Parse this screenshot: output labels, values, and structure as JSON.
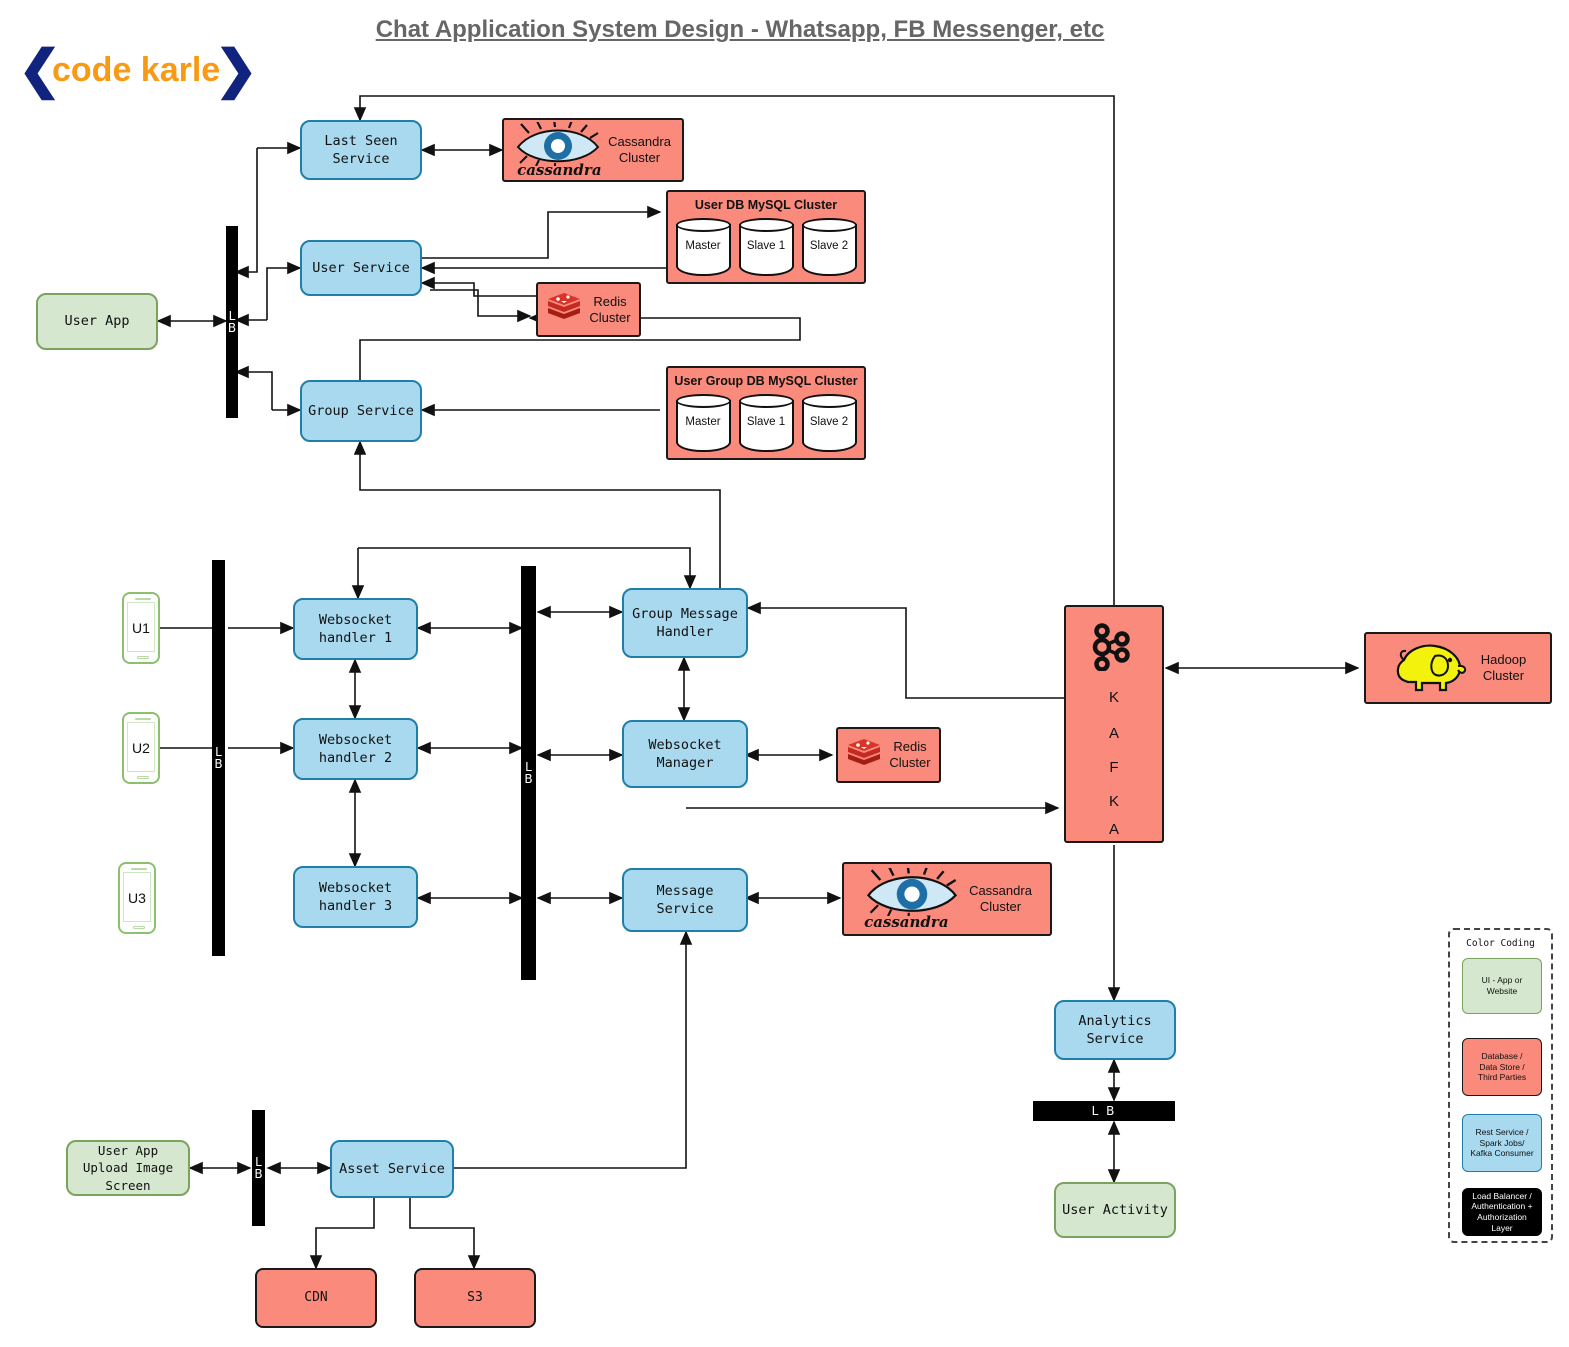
{
  "page": {
    "title": "Chat Application System Design - Whatsapp, FB Messenger, etc",
    "logo": {
      "left_bracket": "❮",
      "word": "code karle",
      "right_bracket": "❯"
    }
  },
  "colors": {
    "service": "#a8d9ef",
    "service_border": "#1f7fa8",
    "datastore": "#fa8a7c",
    "ui": "#d5e8cf",
    "ui_border": "#7aa35f",
    "loadbalancer": "#000000",
    "title_text": "#666666",
    "logo_bracket": "#10237e",
    "logo_word": "#f89a16"
  },
  "ui_clients": {
    "user_app": "User App",
    "user_app_upload": "User App\nUpload Image\nScreen",
    "user_activity": "User Activity",
    "phones": [
      {
        "label": "U1"
      },
      {
        "label": "U2"
      },
      {
        "label": "U3"
      }
    ]
  },
  "load_balancers": {
    "label": "LB",
    "letters": {
      "l": "L",
      "b": "B"
    },
    "horizontal_label": "L B",
    "instances": [
      {
        "name": "lb-user-app"
      },
      {
        "name": "lb-clients"
      },
      {
        "name": "lb-handlers"
      },
      {
        "name": "lb-upload"
      },
      {
        "name": "lb-analytics"
      }
    ]
  },
  "services": [
    {
      "id": "last-seen-service",
      "label": "Last Seen\nService"
    },
    {
      "id": "user-service",
      "label": "User Service"
    },
    {
      "id": "group-service",
      "label": "Group Service"
    },
    {
      "id": "websocket-handler-1",
      "label": "Websocket\nhandler 1"
    },
    {
      "id": "websocket-handler-2",
      "label": "Websocket\nhandler 2"
    },
    {
      "id": "websocket-handler-3",
      "label": "Websocket\nhandler 3"
    },
    {
      "id": "group-message-handler",
      "label": "Group Message\nHandler"
    },
    {
      "id": "websocket-manager",
      "label": "Websocket\nManager"
    },
    {
      "id": "message-service",
      "label": "Message\nService"
    },
    {
      "id": "analytics-service",
      "label": "Analytics\nService"
    },
    {
      "id": "asset-service",
      "label": "Asset Service"
    }
  ],
  "datastores": {
    "cassandra_last_seen": {
      "label": "Cassandra\nCluster",
      "wordmark": "cassandra"
    },
    "cassandra_message": {
      "label": "Cassandra\nCluster",
      "wordmark": "cassandra"
    },
    "redis_user": {
      "label": "Redis\nCluster"
    },
    "redis_ws": {
      "label": "Redis\nCluster"
    },
    "hadoop": {
      "label": "Hadoop\nCluster"
    },
    "kafka": {
      "letters": [
        "K",
        "A",
        "F",
        "K",
        "A"
      ]
    },
    "cdn": {
      "label": "CDN"
    },
    "s3": {
      "label": "S3"
    },
    "user_db": {
      "title": "User DB MySQL Cluster",
      "nodes": [
        "Master",
        "Slave 1",
        "Slave 2"
      ]
    },
    "user_group_db": {
      "title": "User Group DB MySQL Cluster",
      "nodes": [
        "Master",
        "Slave 1",
        "Slave 2"
      ]
    }
  },
  "legend": {
    "title": "Color Coding",
    "items": [
      {
        "key": "ui",
        "label": "UI - App or\nWebsite"
      },
      {
        "key": "db",
        "label": "Database /\nData Store /\nThird Parties"
      },
      {
        "key": "svc",
        "label": "Rest Service /\nSpark Jobs/\nKafka Consumer"
      },
      {
        "key": "lb",
        "label": "Load Balancer /\nAuthentication +\nAuthorization\nLayer"
      }
    ]
  }
}
